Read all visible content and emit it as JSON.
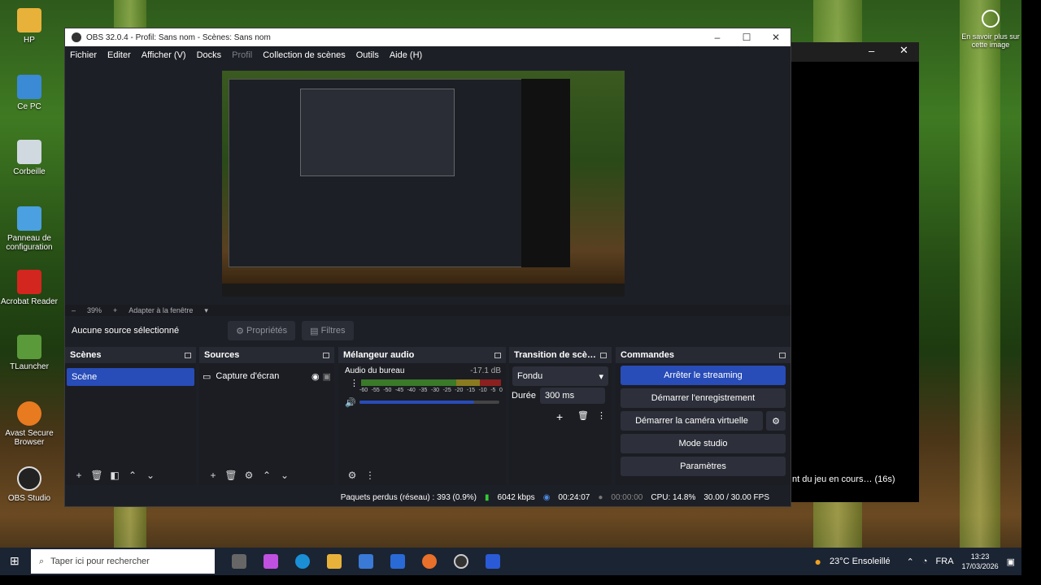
{
  "desktop": {
    "icons": [
      "HP",
      "Ce PC",
      "Corbeille",
      "Panneau de configuration",
      "Acrobat Reader",
      "TLauncher",
      "Avast Secure Browser",
      "OBS Studio"
    ],
    "learn_more": "En savoir plus sur cette image"
  },
  "side_window": {
    "game_text": "nt du jeu en cours… (16s)"
  },
  "obs": {
    "title": "OBS 32.0.4 - Profil: Sans nom - Scènes: Sans nom",
    "menu": [
      "Fichier",
      "Editer",
      "Afficher (V)",
      "Docks",
      "Profil",
      "Collection de scènes",
      "Outils",
      "Aide (H)"
    ],
    "zoom": "39%",
    "fit": "Adapter à la fenêtre",
    "no_source": "Aucune source sélectionné",
    "properties": "Propriétés",
    "filters": "Filtres",
    "scenes": {
      "title": "Scènes",
      "items": [
        "Scène"
      ]
    },
    "sources": {
      "title": "Sources",
      "items": [
        "Capture d'écran"
      ]
    },
    "mixer": {
      "title": "Mélangeur audio",
      "channel": "Audio du bureau",
      "db": "-17.1 dB",
      "scale": [
        "-60",
        "-55",
        "-50",
        "-45",
        "-40",
        "-35",
        "-30",
        "-25",
        "-20",
        "-15",
        "-10",
        "-5",
        "0"
      ],
      "volume_level": 0.82
    },
    "transition": {
      "title": "Transition de scè…",
      "type": "Fondu",
      "duration_label": "Durée",
      "duration": "300 ms"
    },
    "controls": {
      "title": "Commandes",
      "stop_stream": "Arrêter le streaming",
      "start_record": "Démarrer l'enregistrement",
      "virtual_cam": "Démarrer la caméra virtuelle",
      "studio": "Mode studio",
      "settings": "Paramètres"
    },
    "status": {
      "dropped": "Paquets perdus (réseau) : 393 (0.9%)",
      "bitrate": "6042 kbps",
      "stream_time": "00:24:07",
      "rec_time": "00:00:00",
      "cpu": "CPU: 14.8%",
      "fps": "30.00 / 30.00 FPS"
    }
  },
  "taskbar": {
    "search_placeholder": "Taper ici pour rechercher",
    "weather": "23°C  Ensoleillé",
    "lang": "FRA",
    "time": "13:23",
    "date": "17/03/2026"
  }
}
